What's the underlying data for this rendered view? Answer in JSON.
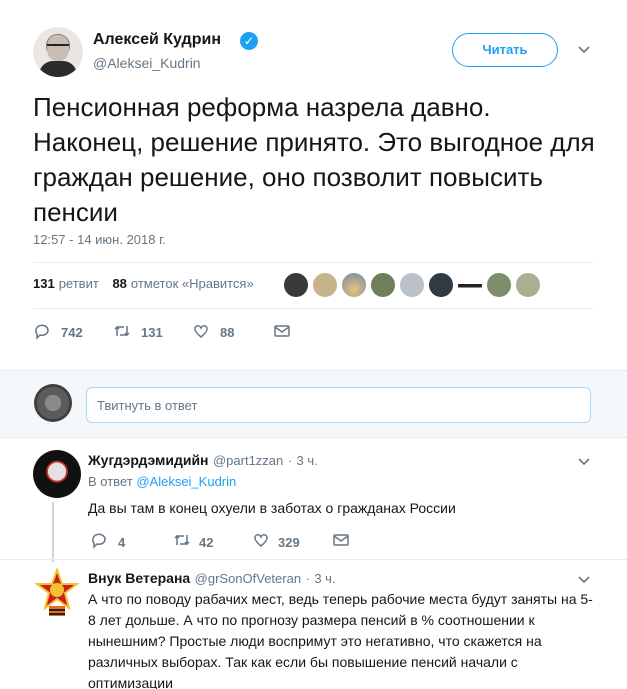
{
  "main_tweet": {
    "author_name": "Алексей Кудрин",
    "verified_glyph": "✓",
    "handle": "@Aleksei_Kudrin",
    "follow_label": "Читать",
    "text": "Пенсионная реформа назрела давно. Наконец, решение принято. Это выгодное для граждан решение, оно позволит повысить пенсии",
    "timestamp": "12:57 - 14 июн. 2018 г.",
    "retweets_count": "131",
    "retweets_label": "ретвит",
    "likes_count": "88",
    "likes_label": "отметок «Нравится»",
    "actions": {
      "replies": "742",
      "retweets": "131",
      "likes": "88"
    }
  },
  "reply_box": {
    "placeholder": "Твитнуть в ответ"
  },
  "replies": [
    {
      "name": "Жугдэрдэмидийн",
      "handle": "@part1zzan",
      "time": "3 ч.",
      "in_reply_prefix": "В ответ",
      "in_reply_to": "@Aleksei_Kudrin",
      "text": "Да вы там в конец охуели в заботах о гражданах России",
      "actions": {
        "replies": "4",
        "retweets": "42",
        "likes": "329"
      }
    },
    {
      "name": "Внук Ветерана",
      "handle": "@grSonOfVeteran",
      "time": "3 ч.",
      "text": "А что по поводу рабачих мест, ведь теперь рабочие места будут заняты на 5-8 лет дольше. А что по прогнозу размера пенсий в % соотношении к нынешним? Простые люди воспримут это негативно, что скажется на различных выборах. Так как если бы повышение пенсий начали с оптимизации"
    }
  ],
  "colors": {
    "accent": "#1da1f2",
    "muted": "#657786",
    "divider": "#e6ecf0"
  }
}
